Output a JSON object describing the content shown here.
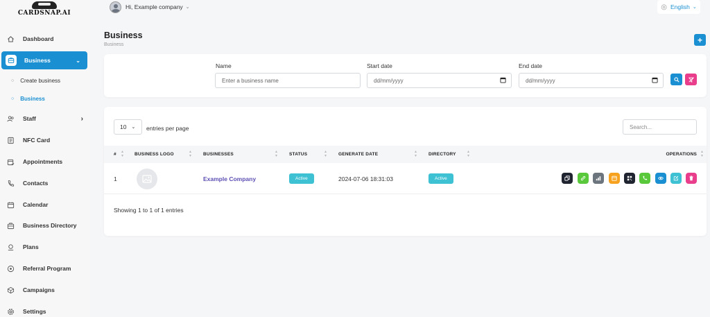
{
  "brand": {
    "name": "CARDSNAP.AI"
  },
  "topbar": {
    "greeting": "Hi, Example company",
    "language": "English"
  },
  "sidebar": {
    "items": [
      {
        "label": "Dashboard",
        "icon": "home-icon"
      },
      {
        "label": "Business",
        "icon": "briefcase-icon",
        "active": true
      },
      {
        "label": "Staff",
        "icon": "users-icon"
      },
      {
        "label": "NFC Card",
        "icon": "card-icon"
      },
      {
        "label": "Appointments",
        "icon": "calendar-check-icon"
      },
      {
        "label": "Contacts",
        "icon": "phone-icon"
      },
      {
        "label": "Calendar",
        "icon": "calendar-icon"
      },
      {
        "label": "Business Directory",
        "icon": "directory-icon"
      },
      {
        "label": "Plans",
        "icon": "plans-icon"
      },
      {
        "label": "Referral Program",
        "icon": "referral-icon"
      },
      {
        "label": "Campaigns",
        "icon": "campaign-icon"
      },
      {
        "label": "Settings",
        "icon": "gear-icon"
      }
    ],
    "sub_items": [
      {
        "label": "Create business"
      },
      {
        "label": "Business"
      }
    ]
  },
  "page": {
    "title": "Business",
    "breadcrumb": "Business"
  },
  "filters": {
    "name_label": "Name",
    "name_placeholder": "Enter a business name",
    "start_label": "Start date",
    "start_value": "dd/mm/yyyy",
    "end_label": "End date",
    "end_value": "dd/mm/yyyy"
  },
  "table": {
    "per_page": "10",
    "per_page_label": "entries per page",
    "search_placeholder": "Search...",
    "headers": {
      "num": "#",
      "logo": "BUSINESS LOGO",
      "business": "BUSINESSES",
      "status": "STATUS",
      "date": "GENERATE DATE",
      "directory": "DIRECTORY",
      "operations": "OPERATIONS"
    },
    "rows": [
      {
        "num": "1",
        "business": "Example Company",
        "status": "Active",
        "date": "2024-07-06 18:31:03",
        "directory": "Active"
      }
    ],
    "footer": "Showing 1 to 1 of 1 entries"
  },
  "colors": {
    "accent": "#1a8fd1",
    "danger": "#e83e8c",
    "badge": "#3ec1d3"
  },
  "operations": [
    {
      "icon": "copy-icon",
      "color": "#1f2430"
    },
    {
      "icon": "link-icon",
      "color": "#59c93b"
    },
    {
      "icon": "chart-icon",
      "color": "#6c757d"
    },
    {
      "icon": "calendar-icon",
      "color": "#f6a21e"
    },
    {
      "icon": "qr-code-icon",
      "color": "#1f2430"
    },
    {
      "icon": "phone-icon",
      "color": "#59c93b"
    },
    {
      "icon": "eye-icon",
      "color": "#1a8fd1"
    },
    {
      "icon": "edit-icon",
      "color": "#3ec1d3"
    },
    {
      "icon": "trash-icon",
      "color": "#e83e8c"
    }
  ]
}
